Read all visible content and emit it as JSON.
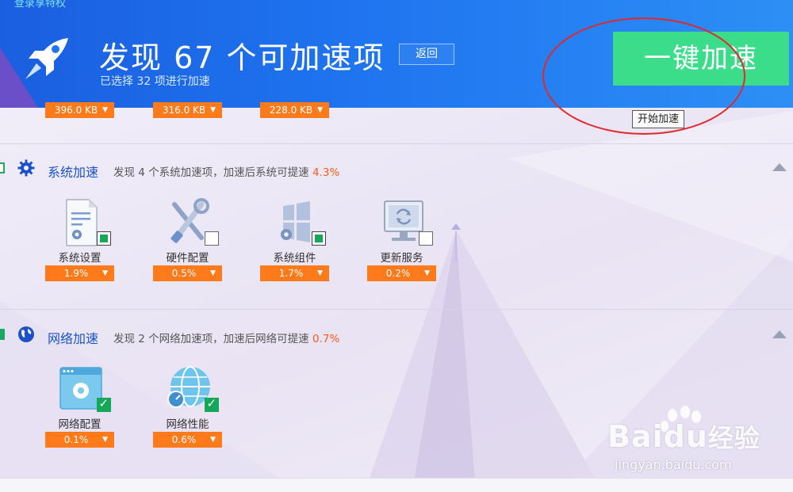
{
  "header": {
    "top_link": "登录享特权",
    "title": "发现 67 个可加速项",
    "subtitle": "已选择 32 项进行加速",
    "back_label": "返回",
    "accelerate_label": "一键加速",
    "tooltip": "开始加速"
  },
  "top_row": [
    {
      "value": "396.0 KB"
    },
    {
      "value": "316.0 KB"
    },
    {
      "value": "228.0 KB"
    }
  ],
  "system_section": {
    "title": "系统加速",
    "desc_prefix": "发现 4 个系统加速项，加速后系统可提速 ",
    "desc_pct": "4.3%",
    "items": [
      {
        "label": "系统设置",
        "value": "1.9%",
        "icon": "settings-document-icon",
        "checked": "partial"
      },
      {
        "label": "硬件配置",
        "value": "0.5%",
        "icon": "tools-icon",
        "checked": "none"
      },
      {
        "label": "系统组件",
        "value": "1.7%",
        "icon": "windows-gear-icon",
        "checked": "partial"
      },
      {
        "label": "更新服务",
        "value": "0.2%",
        "icon": "monitor-refresh-icon",
        "checked": "none"
      }
    ]
  },
  "network_section": {
    "title": "网络加速",
    "desc_prefix": "发现 2 个网络加速项，加速后网络可提速 ",
    "desc_pct": "0.7%",
    "items": [
      {
        "label": "网络配置",
        "value": "0.1%",
        "icon": "browser-gear-icon",
        "checked": "all"
      },
      {
        "label": "网络性能",
        "value": "0.6%",
        "icon": "globe-gauge-icon",
        "checked": "all"
      }
    ]
  },
  "watermark": {
    "brand": "Bai",
    "brand2": "du",
    "brand_cn": "经验",
    "url": "jingyan.baidu.com"
  },
  "colors": {
    "header_blue": "#1f74f0",
    "accelerate_green": "#3bdd8a",
    "dropdown_orange": "#ff7a1a",
    "highlight_red": "#e2282d",
    "check_green": "#16a85a"
  }
}
